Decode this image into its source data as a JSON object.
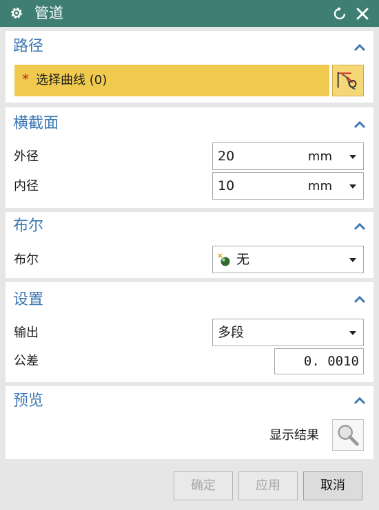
{
  "window": {
    "title": "管道"
  },
  "sections": {
    "path": {
      "title": "路径",
      "select_required_mark": "*",
      "select_label": "选择曲线 (0)"
    },
    "cross_section": {
      "title": "横截面",
      "outer_label": "外径",
      "outer_value": "20",
      "outer_unit": "mm",
      "inner_label": "内径",
      "inner_value": "10",
      "inner_unit": "mm"
    },
    "boolean": {
      "title": "布尔",
      "label": "布尔",
      "value": "无"
    },
    "settings": {
      "title": "设置",
      "output_label": "输出",
      "output_value": "多段",
      "tolerance_label": "公差",
      "tolerance_value": "0. 0010"
    },
    "preview": {
      "title": "预览",
      "show_result_label": "显示结果"
    }
  },
  "buttons": {
    "ok": "确定",
    "apply": "应用",
    "cancel": "取消"
  },
  "colors": {
    "titlebar": "#3f7f73",
    "section_title": "#3c78b4",
    "selection_highlight": "#f0c94f",
    "required_mark": "#c81e1e"
  },
  "icons": {
    "title": "gear-icon",
    "reset": "reset-icon",
    "close": "close-icon",
    "collapse": "chevron-up-icon",
    "select_curve": "curve-select-icon",
    "boolean_none": "boolean-none-icon",
    "show_result": "magnifier-icon"
  }
}
